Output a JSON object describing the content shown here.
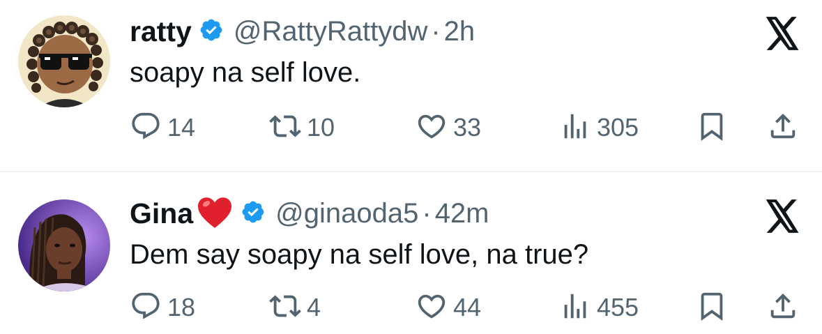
{
  "tweets": [
    {
      "name": "ratty",
      "handle": "@RattyRattydw",
      "separator": "·",
      "time": "2h",
      "text": "soapy na self love.",
      "stats": {
        "replies": "14",
        "retweets": "10",
        "likes": "33",
        "views": "305"
      },
      "name_emoji": null
    },
    {
      "name": "Gina",
      "handle": "@ginaoda5",
      "separator": "·",
      "time": "42m",
      "text": "Dem say soapy na self love, na true?",
      "stats": {
        "replies": "18",
        "retweets": "4",
        "likes": "44",
        "views": "455"
      },
      "name_emoji": "red-heart"
    }
  ],
  "icons": {
    "verified": "verified-badge-icon",
    "brand": "x-logo-icon",
    "reply": "reply-icon",
    "retweet": "retweet-icon",
    "like": "heart-icon",
    "views": "views-icon",
    "bookmark": "bookmark-icon",
    "share": "share-icon"
  },
  "colors": {
    "primary_text": "#0f1419",
    "secondary_text": "#536471",
    "verified_blue": "#1d9bf0",
    "divider": "#eff3f4",
    "heart_emoji": "#e0202c"
  }
}
